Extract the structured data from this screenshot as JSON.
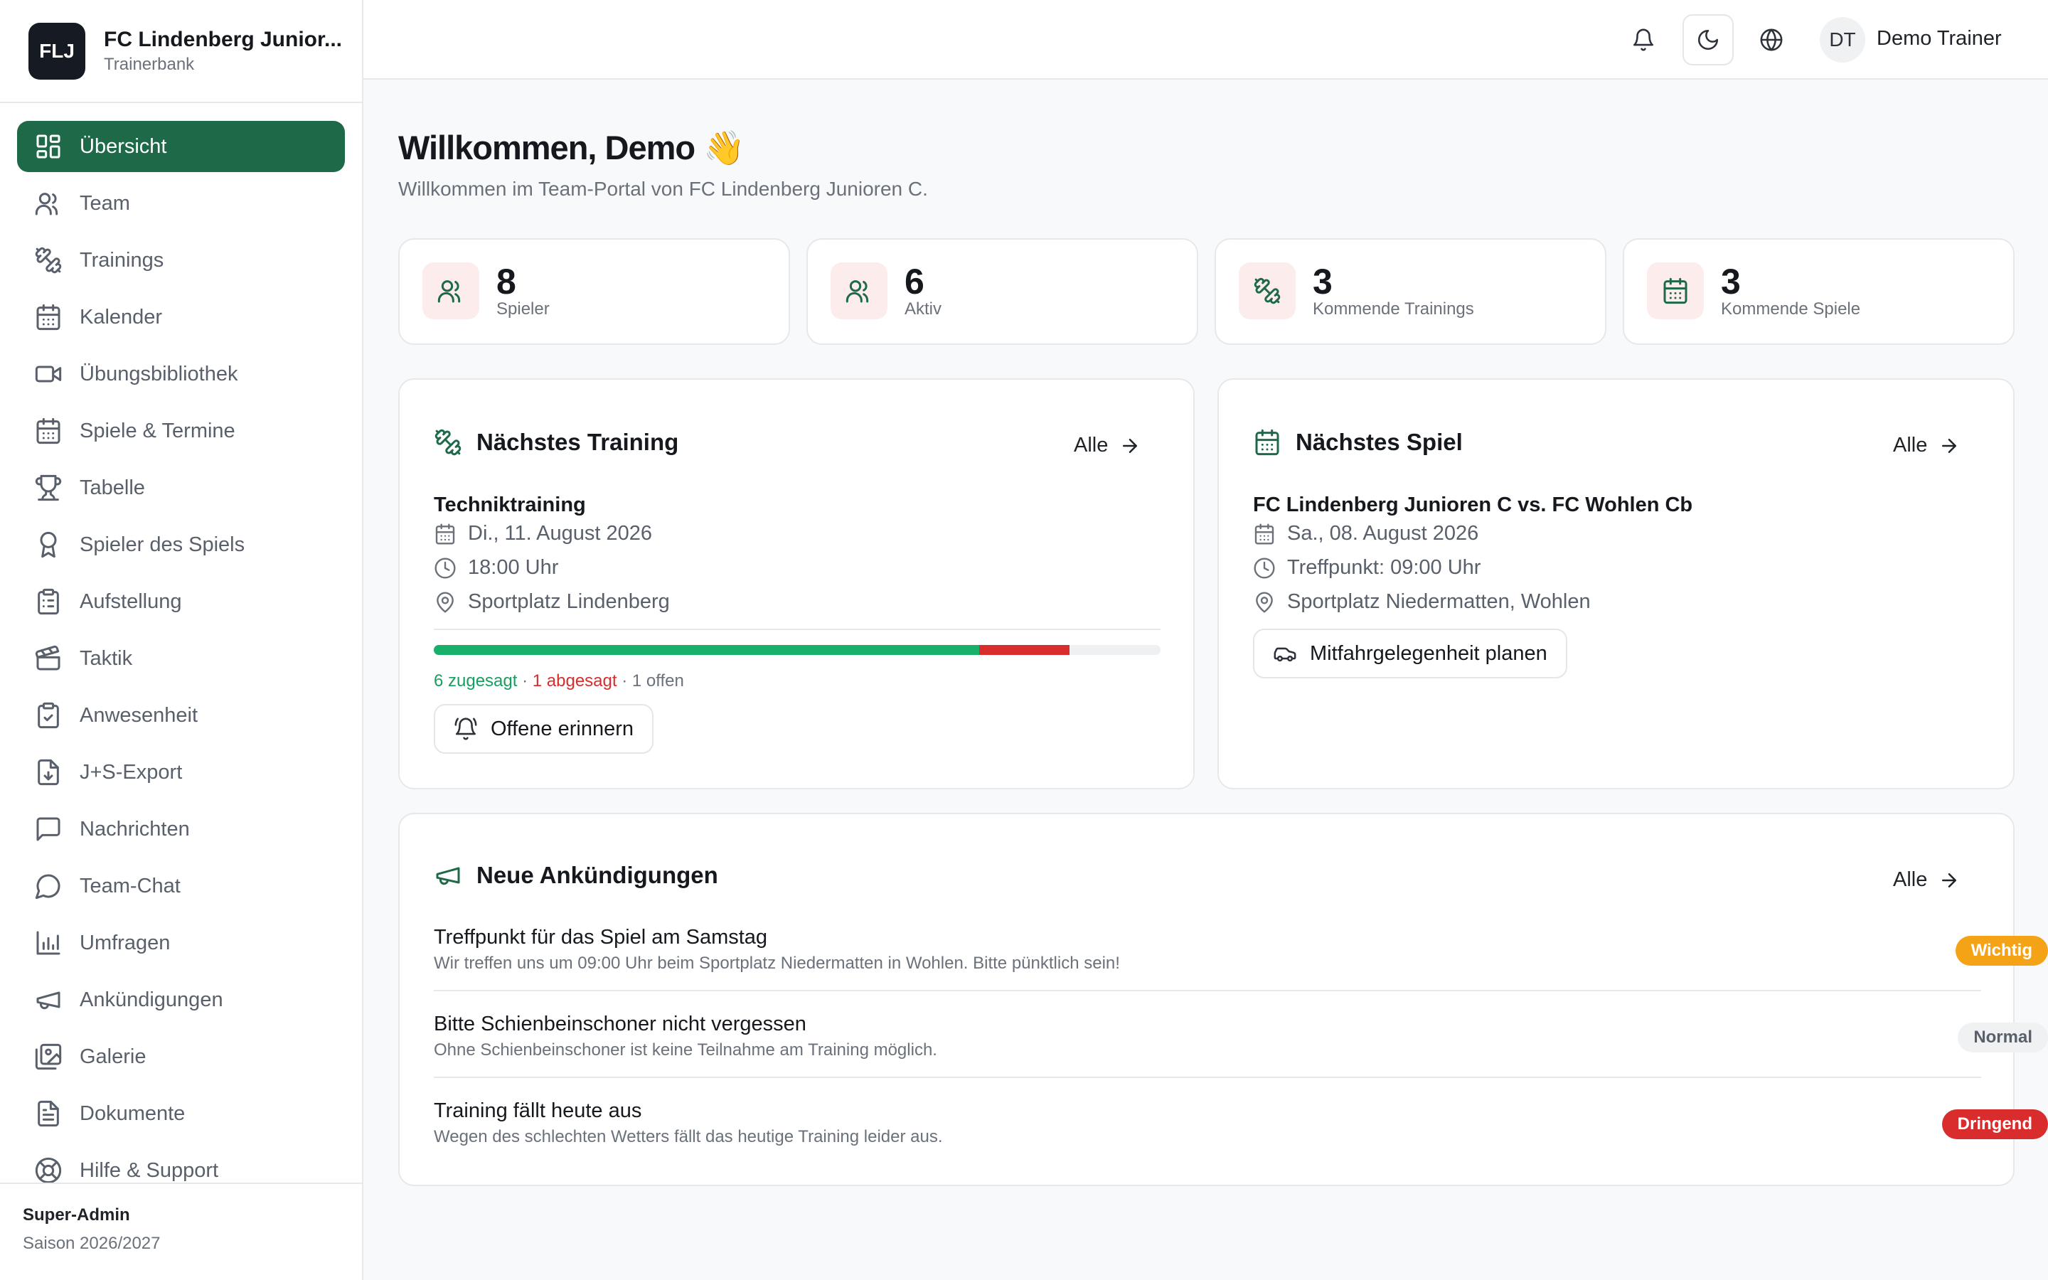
{
  "brand": {
    "logo_text": "FLJ",
    "title": "FC Lindenberg Junior...",
    "subtitle": "Trainerbank"
  },
  "sidebar": {
    "items": [
      {
        "label": "Übersicht",
        "icon": "dashboard-icon",
        "active": true
      },
      {
        "label": "Team",
        "icon": "users-icon"
      },
      {
        "label": "Trainings",
        "icon": "dumbbell-icon"
      },
      {
        "label": "Kalender",
        "icon": "calendar-icon"
      },
      {
        "label": "Übungsbibliothek",
        "icon": "video-icon"
      },
      {
        "label": "Spiele & Termine",
        "icon": "calendar-days-icon"
      },
      {
        "label": "Tabelle",
        "icon": "trophy-icon"
      },
      {
        "label": "Spieler des Spiels",
        "icon": "award-icon"
      },
      {
        "label": "Aufstellung",
        "icon": "clipboard-list-icon"
      },
      {
        "label": "Taktik",
        "icon": "clapperboard-icon"
      },
      {
        "label": "Anwesenheit",
        "icon": "clipboard-check-icon"
      },
      {
        "label": "J+S-Export",
        "icon": "file-download-icon"
      },
      {
        "label": "Nachrichten",
        "icon": "message-square-icon"
      },
      {
        "label": "Team-Chat",
        "icon": "message-circle-icon"
      },
      {
        "label": "Umfragen",
        "icon": "bar-chart-icon"
      },
      {
        "label": "Ankündigungen",
        "icon": "megaphone-icon"
      },
      {
        "label": "Galerie",
        "icon": "gallery-icon"
      },
      {
        "label": "Dokumente",
        "icon": "file-text-icon"
      },
      {
        "label": "Hilfe & Support",
        "icon": "life-buoy-icon"
      }
    ],
    "footer": {
      "role": "Super-Admin",
      "season": "Saison 2026/2027"
    }
  },
  "header": {
    "avatar_initials": "DT",
    "user_name": "Demo Trainer"
  },
  "main": {
    "welcome": "Willkommen, Demo 👋",
    "subtitle": "Willkommen im Team-Portal von FC Lindenberg Junioren C.",
    "stats": [
      {
        "value": "8",
        "label": "Spieler",
        "icon": "users-icon"
      },
      {
        "value": "6",
        "label": "Aktiv",
        "icon": "users-icon"
      },
      {
        "value": "3",
        "label": "Kommende Trainings",
        "icon": "dumbbell-icon"
      },
      {
        "value": "3",
        "label": "Kommende Spiele",
        "icon": "calendar-days-icon"
      }
    ],
    "next_training": {
      "heading": "Nächstes Training",
      "all_label": "Alle",
      "title": "Techniktraining",
      "date": "Di., 11. August 2026",
      "time": "18:00 Uhr",
      "location": "Sportplatz Lindenberg",
      "accepted_fraction": 0.75,
      "declined_fraction": 0.125,
      "accepted_text": "6 zugesagt",
      "declined_text": "1 abgesagt",
      "open_text": "1 offen",
      "separator": "·",
      "remind_label": "Offene erinnern"
    },
    "next_match": {
      "heading": "Nächstes Spiel",
      "all_label": "Alle",
      "title": "FC Lindenberg Junioren C vs. FC Wohlen Cb",
      "date": "Sa., 08. August 2026",
      "meeting": "Treffpunkt: 09:00 Uhr",
      "location": "Sportplatz Niedermatten, Wohlen",
      "carpool_label": "Mitfahrgelegenheit planen"
    },
    "announcements": {
      "heading": "Neue Ankündigungen",
      "all_label": "Alle",
      "items": [
        {
          "title": "Treffpunkt für das Spiel am Samstag",
          "text": "Wir treffen uns um 09:00 Uhr beim Sportplatz Niedermatten in Wohlen. Bitte pünktlich sein!",
          "badge": "Wichtig",
          "badge_bg": "#f4a316",
          "badge_fg": "#ffffff"
        },
        {
          "title": "Bitte Schienbeinschoner nicht vergessen",
          "text": "Ohne Schienbeinschoner ist keine Teilnahme am Training möglich.",
          "badge": "Normal",
          "badge_bg": "#f0f1f3",
          "badge_fg": "#59606b"
        },
        {
          "title": "Training fällt heute aus",
          "text": "Wegen des schlechten Wetters fällt das heutige Training leider aus.",
          "badge": "Dringend",
          "badge_bg": "#d92d2d",
          "badge_fg": "#ffffff"
        }
      ]
    }
  },
  "colors": {
    "accent": "#1e6a48",
    "accepted": "#16b06b",
    "declined": "#d92d2d",
    "icon_tile_bg": "#fdecec"
  }
}
